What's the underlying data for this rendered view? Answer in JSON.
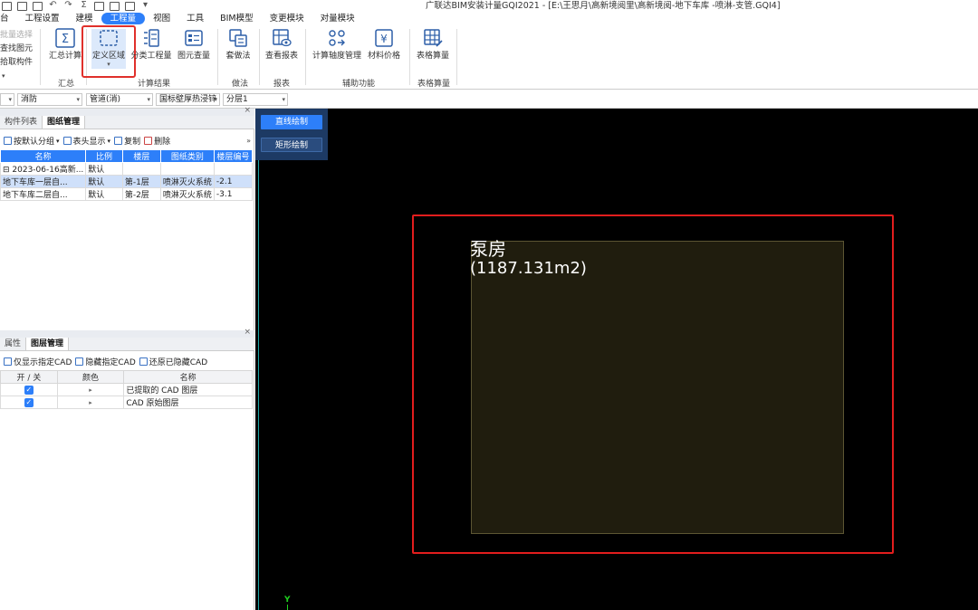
{
  "window": {
    "title": "广联达BIM安装计量GQI2021 - [E:\\王思月\\高新境阅里\\高新境阅-地下车库 -喷淋-支管.GQI4]"
  },
  "menu": {
    "items": [
      "台",
      "工程设置",
      "建模",
      "工程量",
      "视图",
      "工具",
      "BIM模型",
      "变更模块",
      "对量模块"
    ]
  },
  "ribbon": {
    "left_stack": [
      "批量选择",
      "查找图元",
      "拾取构件"
    ],
    "buttons": {
      "summary_calc": "汇总计算",
      "define_region": "定义区域",
      "classify_qty": "分类工程量",
      "element_qty": "图元查量",
      "method": "套做法",
      "view_report": "查看报表",
      "axis_calc": "计算轴度管理",
      "material_price": "材料价格",
      "table_calc": "表格算量"
    },
    "groups": {
      "summary": "汇总",
      "calc_result": "计算结果",
      "method": "做法",
      "report": "报表",
      "aux": "辅助功能",
      "table": "表格算量"
    }
  },
  "dropdowns": [
    "",
    "消防",
    "管道(消)",
    "国标壁厚热浸锌",
    "分层1"
  ],
  "left_top": {
    "tabs": [
      "构件列表",
      "图纸管理"
    ],
    "tools": {
      "group_by_default": "按默认分组",
      "header_display": "表头显示",
      "copy": "复制",
      "delete": "删除"
    },
    "columns": [
      "名称",
      "比例",
      "楼层",
      "图纸类别",
      "楼层编号"
    ],
    "rows": [
      {
        "name": "2023-06-16高新...",
        "scale": "默认",
        "floor": "",
        "category": "",
        "code": ""
      },
      {
        "name": "地下车库一层自...",
        "scale": "默认",
        "floor": "第-1层",
        "category": "喷淋灭火系统",
        "code": "-2.1"
      },
      {
        "name": "地下车库二层自...",
        "scale": "默认",
        "floor": "第-2层",
        "category": "喷淋灭火系统",
        "code": "-3.1"
      }
    ]
  },
  "left_bottom": {
    "tabs": [
      "属性",
      "图层管理"
    ],
    "tools": {
      "show_only": "仅显示指定CAD",
      "hide": "隐藏指定CAD",
      "restore": "还原已隐藏CAD"
    },
    "columns": [
      "开 / 关",
      "颜色",
      "名称"
    ],
    "rows": [
      {
        "name": "已提取的 CAD 图层",
        "on": true
      },
      {
        "name": "CAD 原始图层",
        "on": true
      }
    ]
  },
  "canvas": {
    "draw_line": "直线绘制",
    "draw_rect": "矩形绘制",
    "room_name": "泵房",
    "room_area": "(1187.131m2)",
    "axis_y": "Y"
  },
  "colors": {
    "accent": "#2d7ff9",
    "highlight_red": "#e21d1d",
    "canvas_bg": "#000000"
  }
}
